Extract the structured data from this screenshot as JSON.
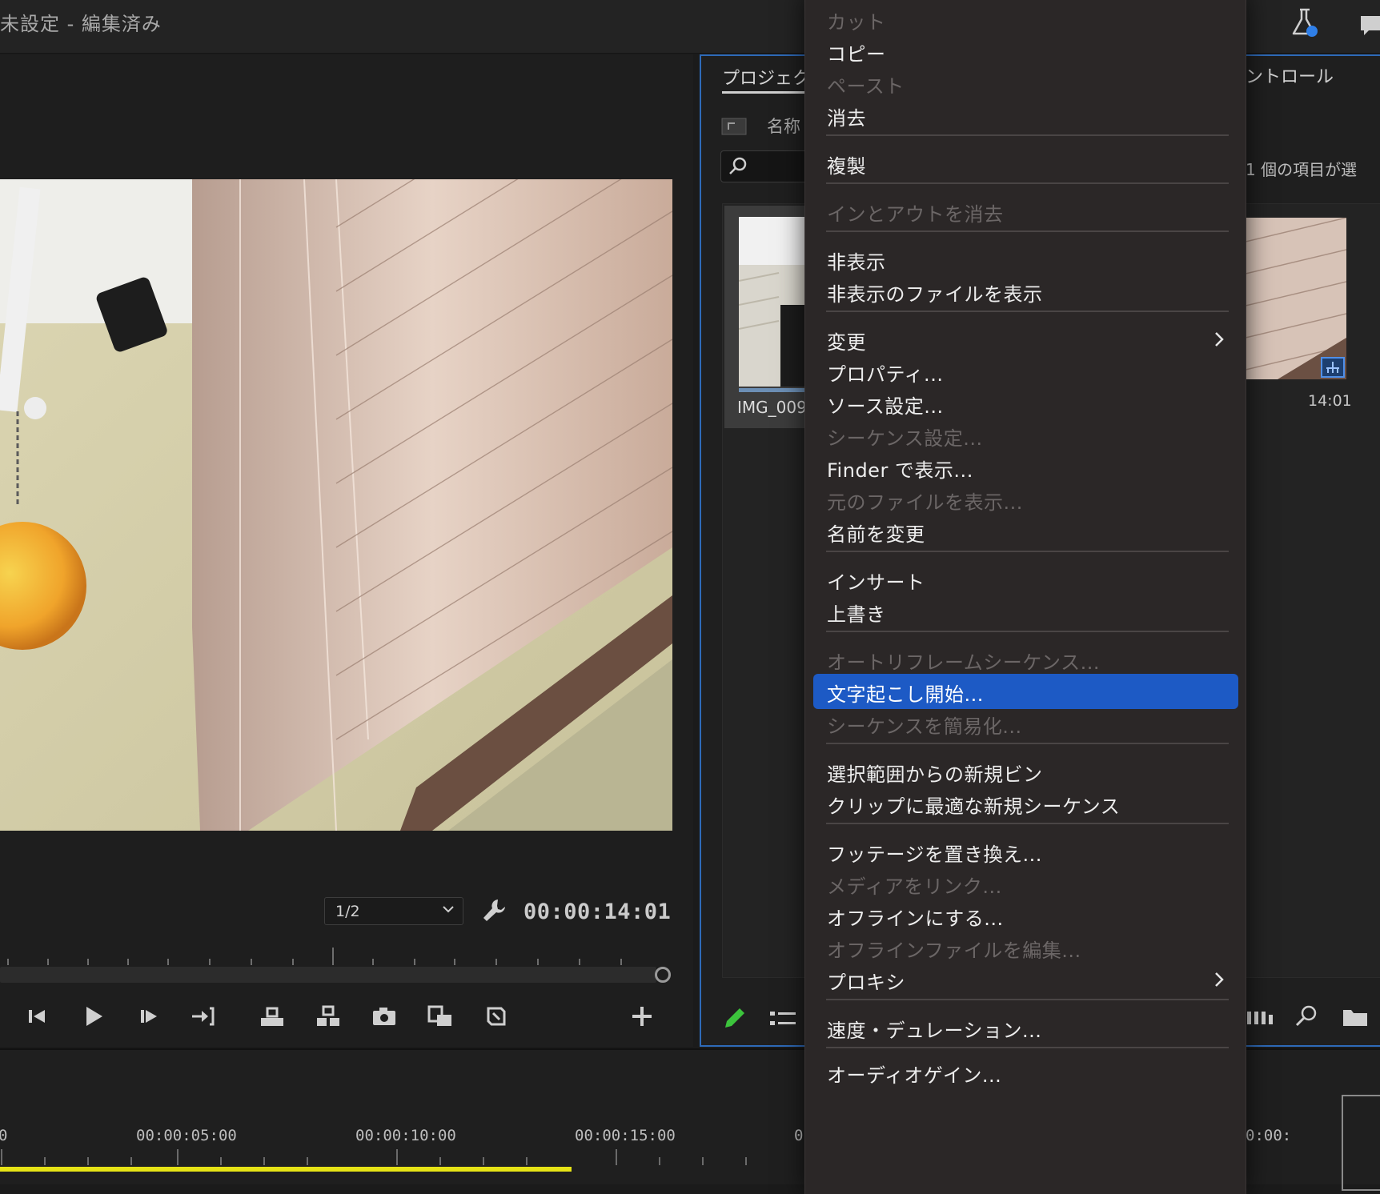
{
  "titlebar": {
    "title": "未設定 - 編集済み"
  },
  "monitor": {
    "zoom_level": "1/2",
    "timecode": "00:00:14:01"
  },
  "project_panel": {
    "tab_label": "プロジェク",
    "column_name": "名称",
    "clip_name": "IMG_009"
  },
  "right_panel": {
    "tab_label": "ントロール",
    "selected_count": "1 個の項目が選",
    "clip_duration": "14:01"
  },
  "timeline": {
    "labels": [
      "0",
      "00:00:05:00",
      "00:00:10:00",
      "00:00:15:00",
      "0"
    ],
    "right_label": "0:00:",
    "work_area_color": "#e6e316"
  },
  "context_menu": {
    "items": [
      {
        "label": "カット",
        "enabled": false
      },
      {
        "label": "コピー",
        "enabled": true
      },
      {
        "label": "ペースト",
        "enabled": false
      },
      {
        "label": "消去",
        "enabled": true
      },
      {
        "label": "複製",
        "enabled": true
      },
      {
        "label": "インとアウトを消去",
        "enabled": false
      },
      {
        "label": "非表示",
        "enabled": true
      },
      {
        "label": "非表示のファイルを表示",
        "enabled": true
      },
      {
        "label": "変更",
        "enabled": true,
        "submenu": true
      },
      {
        "label": "プロパティ...",
        "enabled": true
      },
      {
        "label": "ソース設定...",
        "enabled": true
      },
      {
        "label": "シーケンス設定...",
        "enabled": false
      },
      {
        "label": "Finder で表示...",
        "enabled": true
      },
      {
        "label": "元のファイルを表示...",
        "enabled": false
      },
      {
        "label": "名前を変更",
        "enabled": true
      },
      {
        "label": "インサート",
        "enabled": true
      },
      {
        "label": "上書き",
        "enabled": true
      },
      {
        "label": "オートリフレームシーケンス...",
        "enabled": false
      },
      {
        "label": "文字起こし開始...",
        "enabled": true,
        "highlighted": true
      },
      {
        "label": "シーケンスを簡易化...",
        "enabled": false
      },
      {
        "label": "選択範囲からの新規ビン",
        "enabled": true
      },
      {
        "label": "クリップに最適な新規シーケンス",
        "enabled": true
      },
      {
        "label": "フッテージを置き換え...",
        "enabled": true
      },
      {
        "label": "メディアをリンク...",
        "enabled": false
      },
      {
        "label": "オフラインにする...",
        "enabled": true
      },
      {
        "label": "オフラインファイルを編集...",
        "enabled": false
      },
      {
        "label": "プロキシ",
        "enabled": true,
        "submenu": true
      },
      {
        "label": "速度・デュレーション...",
        "enabled": true
      },
      {
        "label": "オーディオゲイン...",
        "enabled": true
      }
    ]
  },
  "colors": {
    "accent_blue": "#1d5ac5",
    "panel_focus_border": "#2e6ab8"
  },
  "icons": [
    "flask-icon",
    "chat-icon",
    "chevron-down-icon",
    "wrench-icon",
    "step-back-icon",
    "play-icon",
    "step-forward-icon",
    "go-to-out-icon",
    "lift-icon",
    "extract-icon",
    "camera-icon",
    "insert-icon",
    "overwrite-icon",
    "add-icon",
    "folder-up-icon",
    "search-icon",
    "pencil-icon",
    "list-view-icon",
    "freeform-bars-icon",
    "zoom-icon",
    "new-bin-icon",
    "chevron-right-icon"
  ]
}
